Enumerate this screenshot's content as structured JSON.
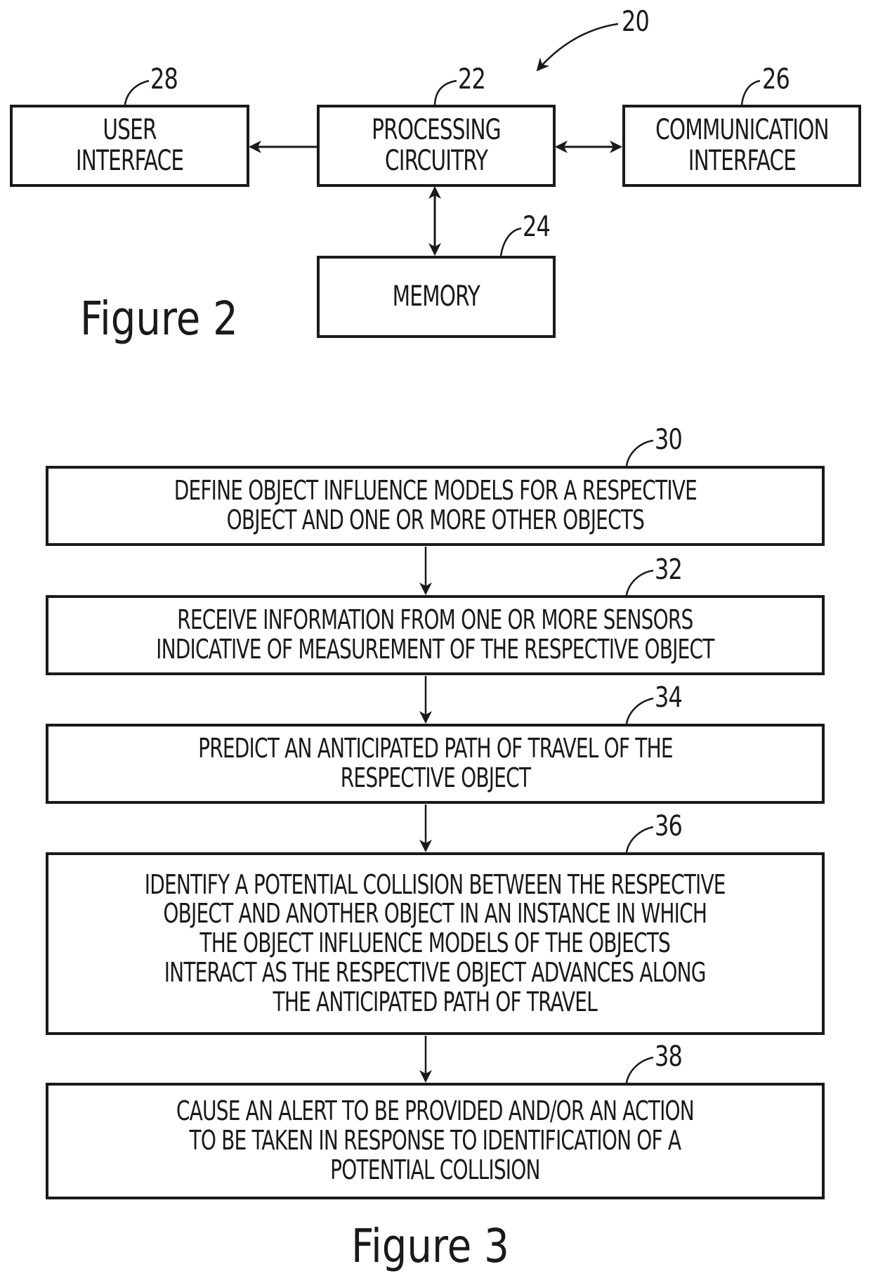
{
  "figure2": {
    "caption": "Figure 2",
    "system_ref": "20",
    "blocks": {
      "user_interface": {
        "ref": "28",
        "label": "USER\nINTERFACE"
      },
      "processing_circuitry": {
        "ref": "22",
        "label": "PROCESSING\nCIRCUITRY"
      },
      "communication_interface": {
        "ref": "26",
        "label": "COMMUNICATION\nINTERFACE"
      },
      "memory": {
        "ref": "24",
        "label": "MEMORY"
      }
    },
    "connections": [
      {
        "from": "processing_circuitry",
        "to": "user_interface",
        "direction": "one-way"
      },
      {
        "from": "processing_circuitry",
        "to": "communication_interface",
        "direction": "bidirectional"
      },
      {
        "from": "processing_circuitry",
        "to": "memory",
        "direction": "bidirectional"
      }
    ]
  },
  "figure3": {
    "caption": "Figure 3",
    "steps": [
      {
        "ref": "30",
        "label": "DEFINE OBJECT INFLUENCE MODELS FOR A RESPECTIVE\nOBJECT AND ONE OR MORE OTHER OBJECTS"
      },
      {
        "ref": "32",
        "label": "RECEIVE INFORMATION FROM ONE OR MORE SENSORS\nINDICATIVE OF MEASUREMENT OF THE RESPECTIVE OBJECT"
      },
      {
        "ref": "34",
        "label": "PREDICT AN ANTICIPATED PATH OF TRAVEL OF THE\nRESPECTIVE OBJECT"
      },
      {
        "ref": "36",
        "label": "IDENTIFY A POTENTIAL COLLISION BETWEEN THE RESPECTIVE\nOBJECT AND ANOTHER OBJECT IN AN INSTANCE IN WHICH\nTHE OBJECT INFLUENCE MODELS OF THE OBJECTS\nINTERACT AS THE RESPECTIVE OBJECT ADVANCES ALONG\nTHE ANTICIPATED PATH OF TRAVEL"
      },
      {
        "ref": "38",
        "label": "CAUSE AN ALERT TO BE PROVIDED AND/OR AN ACTION\nTO BE TAKEN IN RESPONSE TO IDENTIFICATION OF A\nPOTENTIAL COLLISION"
      }
    ]
  }
}
